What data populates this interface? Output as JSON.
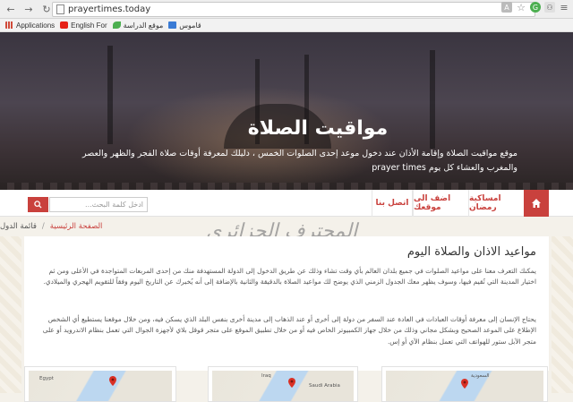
{
  "browser": {
    "url": "prayertimes.today",
    "bookmarks": [
      {
        "label": "Applications",
        "icon": "apps-grid-icon",
        "color": "#d04b3b"
      },
      {
        "label": "English For",
        "icon": "youtube-icon",
        "color": "#e62117"
      },
      {
        "label": "موقع الدراسة",
        "icon": "leaf-icon",
        "color": "#4caf50"
      },
      {
        "label": "قاموس",
        "icon": "book-icon",
        "color": "#3a7bd5"
      }
    ]
  },
  "hero": {
    "title": "مواقيت الصلاة",
    "description": "موقع مواقيت الصلاة وإقامة الأذان عند دخول موعد إحدى الصلوات الخمس ، دليلك لمعرفة أوقات صلاة الفجر والظهر والعصر والمغرب والعشاء كل يوم prayer times"
  },
  "nav": {
    "items": [
      "امساكية رمضان",
      "اضف الى موقعك",
      "اتصل بنا"
    ],
    "search_placeholder": "ادخل كلمة البحث...",
    "accent": "#c9413d"
  },
  "breadcrumb": {
    "home": "الصفحة الرئيسية",
    "separator": "/",
    "current": "قائمة الدول"
  },
  "watermark": "المحترف الجزائري",
  "content": {
    "title": "مواعيد الاذان والصلاة اليوم",
    "paragraph1": "يمكنك التعرف معنا على مواعيد الصلوات في جميع بلدان العالم بأي وقت تشاء وذلك عن طريق الدخول إلى الدولة المستهدفة منك من إحدى المربعات المتواجدة في الأعلى ومن ثم اختيار المدينة التي تُقيم فيها، وسوف يظهر معك الجدول الزمني الذي يوضح لك مواعيد الصلاة بالدقيقة والثانية بالإضافة إلى أنه يُخبرك عن التاريخ اليوم وفقاً للتقويم الهجري والميلادي.",
    "paragraph2": "يحتاج الإنسان إلى معرفة أوقات العبادات في العادة عند السفر من دولة إلى أخرى أو عند الذهاب إلى مدينة أخرى بنفس البلد الذي يسكن فيه، ومن خلال موقعنا يستطيع أي الشخص الإطلاع على الموعد الصحيح وبشكل مجاني وذلك من خلال جهاز الكمبيوتر الخاص فيه أو من خلال تطبيق الموقع على متجر قوقل بلاي لأجهزة الجوال التي تعمل بنظام الاندرويد أو على متجر الآبل ستور للهواتف التي تعمل بنظام الآي أو إس."
  },
  "maps": [
    {
      "label": "Egypt"
    },
    {
      "label": "Iraq"
    },
    {
      "label": "Saudi Arabia"
    },
    {
      "label": "السعودية"
    }
  ]
}
